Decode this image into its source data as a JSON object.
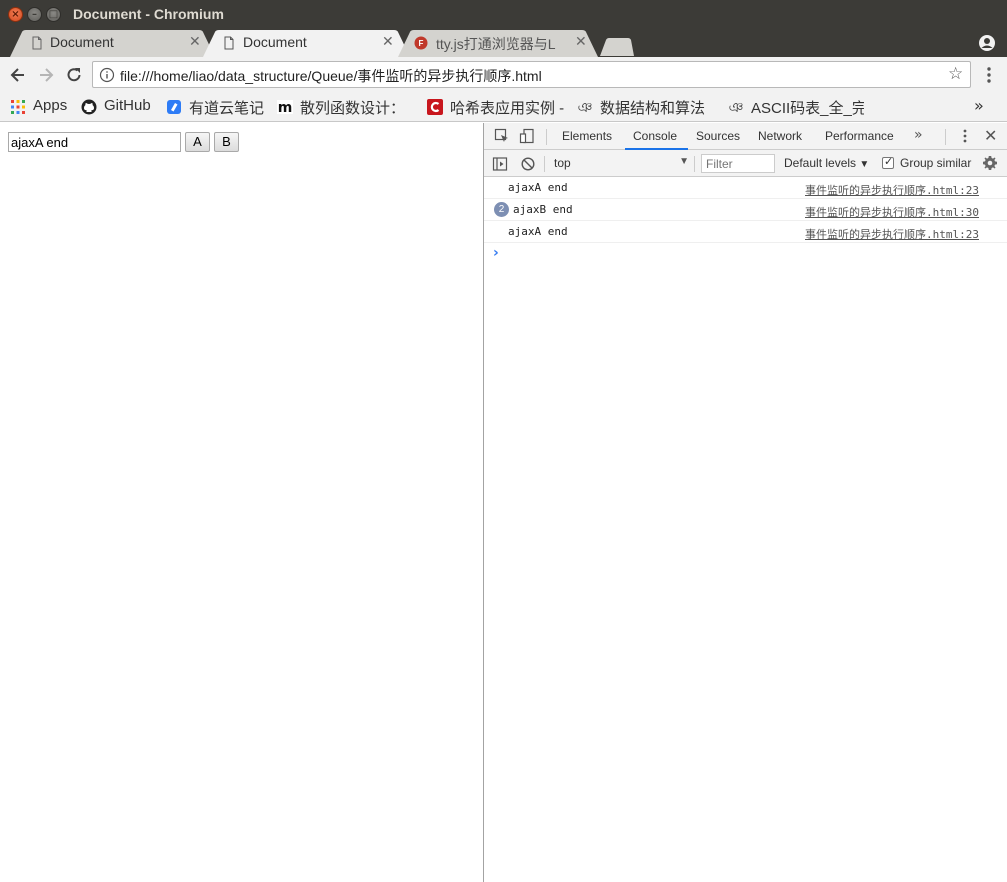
{
  "window": {
    "title": "Document - Chromium"
  },
  "tabs": [
    {
      "title": "Document",
      "icon": "page-icon",
      "active": false
    },
    {
      "title": "Document",
      "icon": "page-icon",
      "active": true
    },
    {
      "title": "tty.js打通浏览器与L",
      "icon": "favicon-red",
      "active": false
    }
  ],
  "toolbar": {
    "url": "file:///home/liao/data_structure/Queue/事件监听的异步执行顺序.html"
  },
  "bookmarks": [
    {
      "label": "Apps",
      "icon": "apps-grid-icon"
    },
    {
      "label": "GitHub",
      "icon": "github-icon"
    },
    {
      "label": "有道云笔记",
      "icon": "youdao-icon"
    },
    {
      "label": "散列函数设计：",
      "icon": "m-icon"
    },
    {
      "label": "哈希表应用实例 -",
      "icon": "c-icon"
    },
    {
      "label": "数据结构和算法",
      "icon": "script-icon"
    },
    {
      "label": "ASCII码表_全_完",
      "icon": "script-icon"
    }
  ],
  "page": {
    "input_value": "ajaxA end",
    "button_a": "A",
    "button_b": "B"
  },
  "devtools": {
    "tabs": [
      "Elements",
      "Console",
      "Sources",
      "Network",
      "Performance"
    ],
    "active_tab": "Console",
    "context": "top",
    "filter_placeholder": "Filter",
    "levels": "Default levels",
    "group_similar": "Group similar",
    "group_similar_checked": true,
    "logs": [
      {
        "count": "",
        "message": "ajaxA end",
        "source": "事件监听的异步执行顺序.html:23"
      },
      {
        "count": "2",
        "message": "ajaxB end",
        "source": "事件监听的异步执行顺序.html:30"
      },
      {
        "count": "",
        "message": "ajaxA end",
        "source": "事件监听的异步执行顺序.html:23"
      }
    ]
  },
  "colors": {
    "titlebar": "#3c3b37",
    "active_tab": "#f2f2f2",
    "devtools_accent": "#1a73e8"
  }
}
